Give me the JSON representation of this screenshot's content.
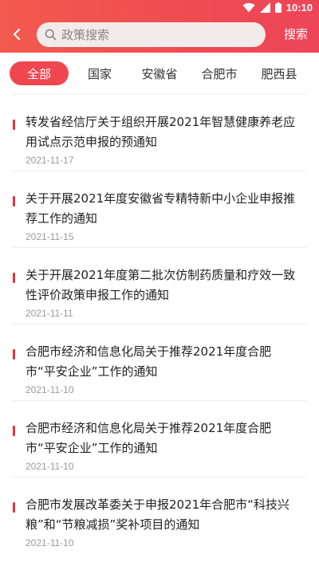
{
  "colors": {
    "brand": "#ef4c52",
    "accent_bar": "#e8323d",
    "date_gray": "#9a9a9a"
  },
  "status_bar": {
    "time": "10:10",
    "icons": [
      "wifi-icon",
      "signal-icon",
      "battery-icon"
    ]
  },
  "header": {
    "back_icon": "chevron-left-icon",
    "search": {
      "icon": "search-icon",
      "placeholder": "政策搜索",
      "value": ""
    },
    "search_button_label": "搜索"
  },
  "tabs": [
    {
      "label": "全部",
      "active": true
    },
    {
      "label": "国家",
      "active": false
    },
    {
      "label": "安徽省",
      "active": false
    },
    {
      "label": "合肥市",
      "active": false
    },
    {
      "label": "肥西县",
      "active": false
    }
  ],
  "policies": [
    {
      "title": "转发省经信厅关于组织开展2021年智慧健康养老应用试点示范申报的预通知",
      "date": "2021-11-17"
    },
    {
      "title": "关于开展2021年度安徽省专精特新中小企业申报推荐工作的通知",
      "date": "2021-11-15"
    },
    {
      "title": "关于开展2021年度第二批次仿制药质量和疗效一致性评价政策申报工作的通知",
      "date": "2021-11-11"
    },
    {
      "title": "合肥市经济和信息化局关于推荐2021年度合肥市“平安企业”工作的通知",
      "date": "2021-11-10"
    },
    {
      "title": "合肥市经济和信息化局关于推荐2021年度合肥市“平安企业”工作的通知",
      "date": "2021-11-10"
    },
    {
      "title": "合肥市发展改革委关于申报2021年合肥市“科技兴粮”和“节粮减损”奖补项目的通知",
      "date": "2021-11-10"
    }
  ]
}
